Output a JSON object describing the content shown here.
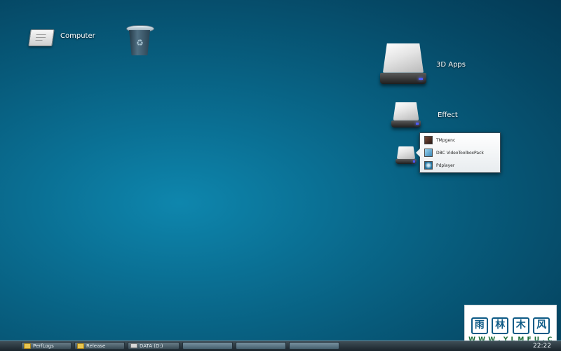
{
  "desktop": {
    "icons": [
      {
        "label": "Computer"
      },
      {
        "label": ""
      },
      {
        "label": "3D Apps"
      },
      {
        "label": "Effect"
      }
    ]
  },
  "popup": {
    "items": [
      {
        "label": "TMpgenc",
        "icon": "app-icon"
      },
      {
        "label": "DBC VideoToolboxPack",
        "icon": "app-icon"
      },
      {
        "label": "Pdplayer",
        "icon": "app-icon"
      }
    ]
  },
  "taskbar": {
    "buttons": [
      {
        "label": "PerfLogs",
        "icon": "folder-icon"
      },
      {
        "label": "Release",
        "icon": "folder-icon"
      },
      {
        "label": "DATA (D:)",
        "icon": "drive-icon"
      }
    ],
    "clock": "22:22"
  },
  "watermark": {
    "logo_text": "雨林木风",
    "url": "W W W . Y L M F U . C o M"
  }
}
